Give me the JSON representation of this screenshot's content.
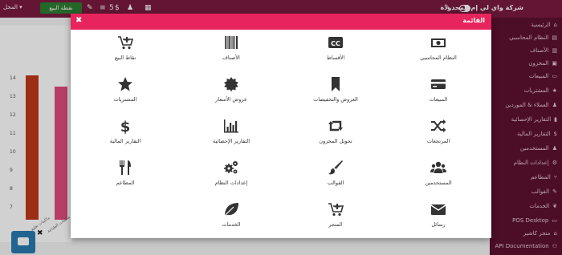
{
  "topbar": {
    "brand": "شركة واي لي إم المحدودة",
    "pos_button": "نقطة البيع",
    "store_label": "المحل ▾",
    "counter": "5",
    "counter_symbol": "$"
  },
  "sidebar": {
    "items": [
      {
        "label": "الرئيسية",
        "icon": "home-icon"
      },
      {
        "label": "النظام المحاسبي",
        "icon": "ledger-icon"
      },
      {
        "label": "الأصناف",
        "icon": "barcode-icon"
      },
      {
        "label": "المخزون",
        "icon": "box-icon"
      },
      {
        "label": "المبيعات",
        "icon": "card-icon"
      },
      {
        "label": "المشتريات",
        "icon": "star-icon"
      },
      {
        "label": "العملاء & الموردين",
        "icon": "users-icon"
      },
      {
        "label": "التقارير الإحصائية",
        "icon": "chart-icon"
      },
      {
        "label": "التقارير المالية",
        "icon": "dollar-icon"
      },
      {
        "label": "المستخدمين",
        "icon": "user-icon"
      },
      {
        "label": "إعدادات النظام",
        "icon": "cog-icon"
      },
      {
        "label": "المطاعم",
        "icon": "cutlery-icon"
      },
      {
        "label": "القوالب",
        "icon": "brush-icon"
      },
      {
        "label": "الخدمات",
        "icon": "leaf-icon"
      },
      {
        "label": "POS Desktop",
        "icon": "desktop-icon"
      },
      {
        "label": "متجر كاشير",
        "icon": "store-icon"
      },
      {
        "label": "API Documentation",
        "icon": "api-icon"
      }
    ]
  },
  "modal": {
    "title": "القائمة",
    "close": "✖",
    "tiles": [
      {
        "label": "النظام المحاسبي",
        "icon": "money-icon"
      },
      {
        "label": "الأقساط",
        "icon": "cc-icon"
      },
      {
        "label": "الأصناف",
        "icon": "barcode-icon"
      },
      {
        "label": "نقاط البيع",
        "icon": "cart-plus-icon"
      },
      {
        "label": "المبيعات",
        "icon": "credit-card-icon"
      },
      {
        "label": "العروض والتخفيضات",
        "icon": "bookmark-icon"
      },
      {
        "label": "عروض الأسعار",
        "icon": "certificate-icon"
      },
      {
        "label": "المشتريات",
        "icon": "star-icon"
      },
      {
        "label": "المرتجعات",
        "icon": "shuffle-icon"
      },
      {
        "label": "تحويل المخزون",
        "icon": "retweet-icon"
      },
      {
        "label": "التقارير الإحصائية",
        "icon": "bar-chart-icon"
      },
      {
        "label": "التقارير المالية",
        "icon": "dollar-icon"
      },
      {
        "label": "المستخدمين",
        "icon": "users-icon"
      },
      {
        "label": "القوالب",
        "icon": "paint-brush-icon"
      },
      {
        "label": "إعدادات النظام",
        "icon": "cogs-icon"
      },
      {
        "label": "المطاعم",
        "icon": "cutlery-icon"
      },
      {
        "label": "رسائل",
        "icon": "envelope-icon"
      },
      {
        "label": "المتجر",
        "icon": "cart-plus-icon"
      },
      {
        "label": "الخدمات",
        "icon": "leaf-icon"
      }
    ]
  },
  "background_chart": {
    "ticks": [
      "14",
      "13",
      "12",
      "11",
      "10",
      "9",
      "8",
      "7"
    ],
    "categories": [
      "ماكينات تغليف التعبئة",
      "ماكينات الطباعة"
    ],
    "colors": {
      "bar1": "#c0391b",
      "bar2": "#e14b7d"
    }
  },
  "colors": {
    "topbar": "#7b1a40",
    "sidebar": "#5d1030",
    "accent": "#e8245c"
  }
}
